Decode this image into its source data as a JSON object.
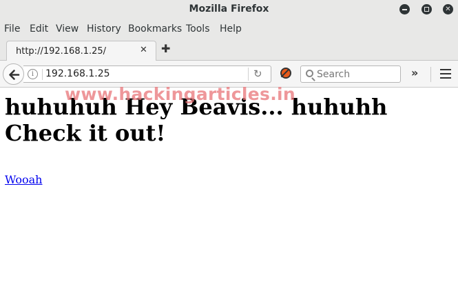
{
  "window": {
    "title": "Mozilla Firefox"
  },
  "menu": {
    "items": [
      {
        "label": "File"
      },
      {
        "label": "Edit"
      },
      {
        "label": "View"
      },
      {
        "label": "History"
      },
      {
        "label": "Bookmarks"
      },
      {
        "label": "Tools"
      },
      {
        "label": "Help"
      }
    ]
  },
  "tabs": [
    {
      "label": "http://192.168.1.25/",
      "active": true
    }
  ],
  "navbar": {
    "url": "192.168.1.25",
    "search_placeholder": "Search"
  },
  "page": {
    "watermark": "www.hackingarticles.in",
    "heading": "huhuhuh Hey Beavis... huhuhh Check it out!",
    "link_text": "Wooah"
  },
  "colors": {
    "link": "#0000ee",
    "watermark": "#e87478",
    "chrome": "#e8e8e7"
  }
}
